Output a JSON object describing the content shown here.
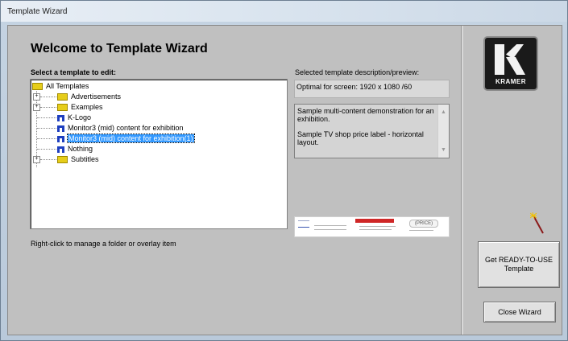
{
  "window": {
    "title": "Template Wizard"
  },
  "header": {
    "heading": "Welcome to Template Wizard"
  },
  "tree": {
    "label": "Select a template to edit:",
    "items": [
      {
        "label": "All Templates",
        "type": "folder",
        "level": 0,
        "expandable": false
      },
      {
        "label": "Advertisements",
        "type": "folder",
        "level": 1,
        "expandable": true
      },
      {
        "label": "Examples",
        "type": "folder",
        "level": 1,
        "expandable": true
      },
      {
        "label": "K-Logo",
        "type": "template",
        "level": 1,
        "expandable": false
      },
      {
        "label": "Monitor3 (mid) content for exhibition",
        "type": "template",
        "level": 1,
        "expandable": false
      },
      {
        "label": "Monitor3 (mid) content for exhibition(1)",
        "type": "template",
        "level": 1,
        "expandable": false,
        "selected": true
      },
      {
        "label": "Nothing",
        "type": "template",
        "level": 1,
        "expandable": false
      },
      {
        "label": "Subtitles",
        "type": "folder",
        "level": 1,
        "expandable": true
      }
    ],
    "hint": "Right-click to manage a folder or overlay item"
  },
  "description": {
    "label": "Selected template description/preview:",
    "screen": "Optimal for screen: 1920 x 1080 /60",
    "lines": [
      "Sample multi-content demonstration for an exhibition.",
      "Sample TV shop price label - horizontal layout."
    ],
    "preview_pill": "(PRICE)"
  },
  "logo": {
    "text": "KRAMER"
  },
  "buttons": {
    "get_ready_line1": "Get READY-TO-USE",
    "get_ready_line2": "Template",
    "close": "Close Wizard"
  },
  "colors": {
    "selection": "#3399ff",
    "folder": "#e6cd1a",
    "template_icon": "#1e3fbf"
  }
}
